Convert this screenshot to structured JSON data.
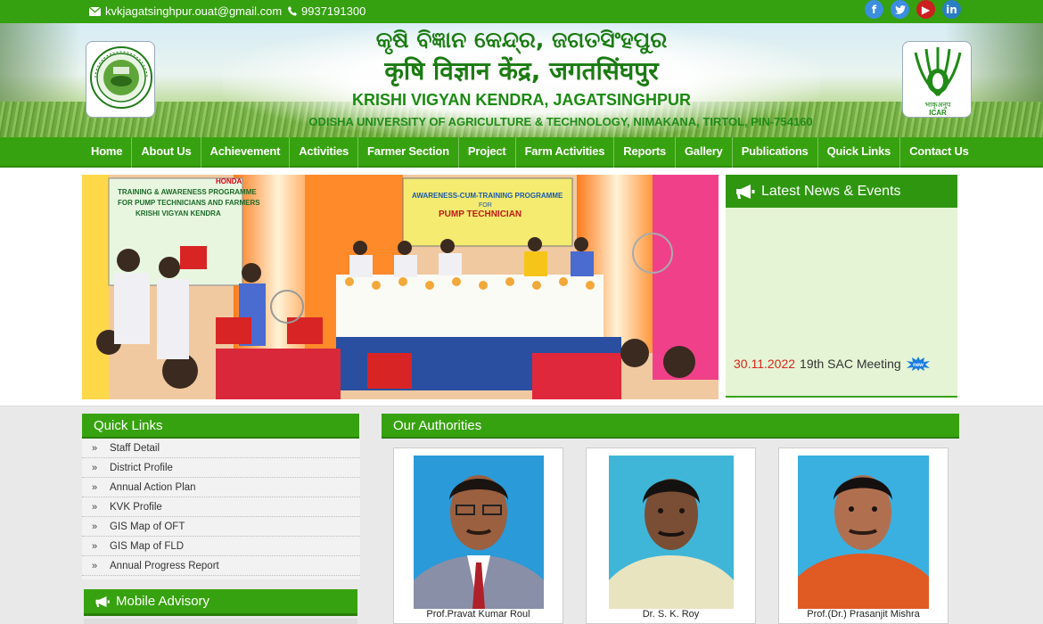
{
  "topbar": {
    "email": "kvkjagatsinghpur.ouat@gmail.com",
    "phone": "9937191300",
    "social": [
      {
        "icon": "facebook-icon",
        "glyph": "f",
        "color": "#3b8ee0"
      },
      {
        "icon": "twitter-icon",
        "glyph": "t",
        "color": "#3b8ee0"
      },
      {
        "icon": "youtube-icon",
        "glyph": "▶",
        "color": "#cc1f1f"
      },
      {
        "icon": "linkedin-icon",
        "glyph": "in",
        "color": "#2a7fc4"
      }
    ]
  },
  "header": {
    "title_odia": "କୃଷି ବିଜ୍ଞାନ କେନ୍ଦ୍ର, ଜଗତସିଂହପୁର",
    "title_hindi": "कृषि विज्ञान केंद्र, जगतसिंघपुर",
    "title_english": "KRISHI VIGYAN KENDRA, JAGATSINGHPUR",
    "subtitle": "ODISHA UNIVERSITY OF AGRICULTURE & TECHNOLOGY,  NIMAKANA, TIRTOL, PIN-754160",
    "right_logo_text_top": "भाकृअनुप",
    "right_logo_text_bottom": "ICAR"
  },
  "nav": [
    "Home",
    "About Us",
    "Achievement",
    "Activities",
    "Farmer Section",
    "Project",
    "Farm Activities",
    "Reports",
    "Gallery",
    "Publications",
    "Quick Links",
    "Contact Us"
  ],
  "slider": {
    "banner_left_line1": "TRAINING & AWARENESS PROGRAMME",
    "banner_left_line2": "FOR PUMP TECHNICIANS AND FARMERS",
    "banner_left_line3": "KRISHI VIGYAN KENDRA",
    "banner_top_line1": "AWARENESS-CUM-TRAINING PROGRAMME",
    "banner_top_line2": "FOR",
    "banner_top_line3": "PUMP TECHNICIAN",
    "brand": "HONDA"
  },
  "news": {
    "heading": "Latest News & Events",
    "items": [
      {
        "date": "30.11.2022",
        "text": "19th SAC Meeting",
        "badge": "new"
      }
    ]
  },
  "quick_links": {
    "heading": "Quick Links",
    "items": [
      "Staff Detail",
      "District Profile",
      "Annual Action Plan",
      "KVK Profile",
      "GIS Map of OFT",
      "GIS Map of FLD",
      "Annual Progress Report"
    ]
  },
  "mobile_advisory": {
    "heading": "Mobile Advisory"
  },
  "authorities": {
    "heading": "Our Authorities",
    "people": [
      {
        "name": "Prof.Pravat Kumar Roul"
      },
      {
        "name": "Dr. S. K. Roy"
      },
      {
        "name": "Prof.(Dr.) Prasanjit Mishra"
      }
    ]
  },
  "colors": {
    "brand_green": "#37a20f",
    "news_date_red": "#d9261c"
  }
}
